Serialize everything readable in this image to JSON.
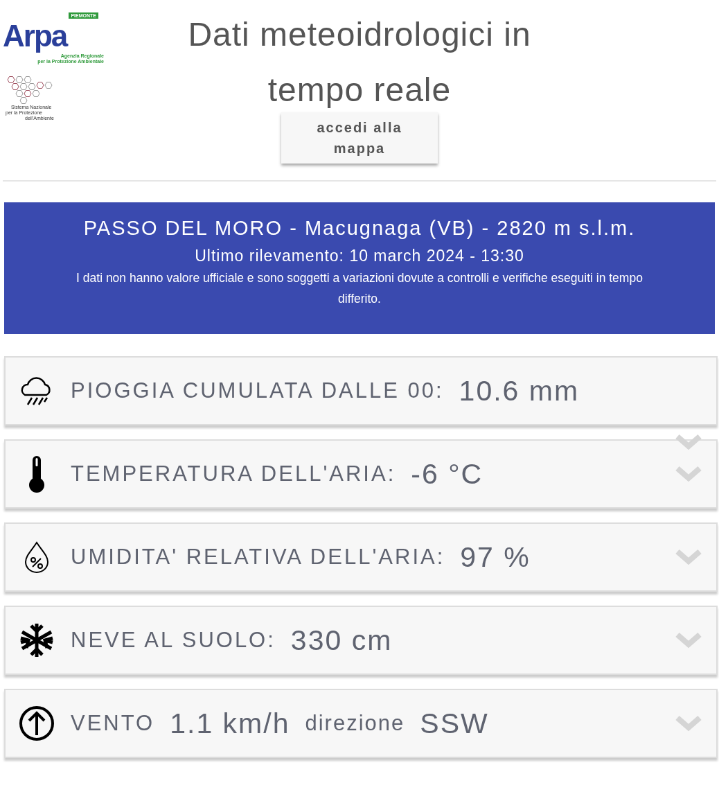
{
  "logos": {
    "arpa": {
      "region": "PIEMONTE",
      "name": "Arpa",
      "tagline": [
        "Agenzia Regionale",
        "per la Protezione Ambientale"
      ]
    },
    "snpa": {
      "lines": [
        "Sistema Nazionale",
        "per la Protezione",
        "dell'Ambiente"
      ]
    }
  },
  "title": "Dati meteoidrologici in tempo reale",
  "map_button": "accedi alla mappa",
  "station": {
    "name": "PASSO DEL MORO - Macugnaga (VB) - 2820 m s.l.m.",
    "last_reading": "Ultimo rilevamento: 10 march 2024 - 13:30",
    "disclaimer": "I dati non hanno valore ufficiale e sono soggetti a variazioni dovute a controlli e verifiche eseguiti in tempo differito."
  },
  "measures": [
    {
      "kind": "rain",
      "label": "PIOGGIA CUMULATA DALLE 00:",
      "value": "10.6 mm",
      "chevron": true,
      "chevron_misaligned": true
    },
    {
      "kind": "temperature",
      "label": "TEMPERATURA DELL'ARIA:",
      "value": "-6 °C",
      "chevron": true,
      "chevron_misaligned": false
    },
    {
      "kind": "humidity",
      "label": "UMIDITA' RELATIVA DELL'ARIA:",
      "value": "97 %",
      "chevron": true,
      "chevron_misaligned": false
    },
    {
      "kind": "snow",
      "label": "NEVE AL SUOLO:",
      "value": "330 cm",
      "chevron": true,
      "chevron_misaligned": false
    },
    {
      "kind": "wind",
      "label": "VENTO",
      "value": "1.1 km/h",
      "direction_label": "direzione",
      "direction": "SSW",
      "chevron": true,
      "chevron_misaligned": false
    }
  ]
}
